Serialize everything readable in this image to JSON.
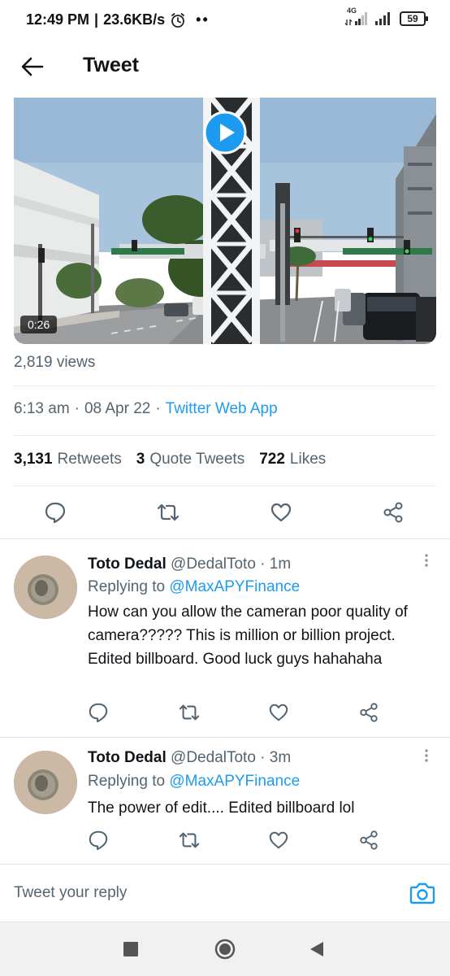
{
  "status_bar": {
    "time": "12:49 PM",
    "speed": "23.6KB/s",
    "dots": "••",
    "network": "4G",
    "battery": "59"
  },
  "header": {
    "title": "Tweet"
  },
  "media": {
    "duration": "0:26"
  },
  "views": "2,819 views",
  "meta": {
    "time": "6:13 am",
    "sep1": "·",
    "date": "08 Apr 22",
    "sep2": "·",
    "source": "Twitter Web App"
  },
  "stats": {
    "retweets_count": "3,131",
    "retweets_label": "Retweets",
    "quotes_count": "3",
    "quotes_label": "Quote Tweets",
    "likes_count": "722",
    "likes_label": "Likes"
  },
  "replies": [
    {
      "name": "Toto Dedal",
      "handle": "@DedalToto · 1m",
      "replying_label": "Replying to",
      "mention": "@MaxAPYFinance",
      "text": "How can you allow the cameran poor quality of camera????? This is million or billion project. Edited  billboard. Good luck guys hahahaha"
    },
    {
      "name": "Toto Dedal",
      "handle": "@DedalToto · 3m",
      "replying_label": "Replying to",
      "mention": "@MaxAPYFinance",
      "text": "The power of edit.... Edited billboard lol"
    }
  ],
  "reply_box": {
    "placeholder": "Tweet your reply"
  },
  "colors": {
    "accent": "#1d9bf0",
    "text_primary": "#0f1419",
    "text_secondary": "#536471"
  }
}
